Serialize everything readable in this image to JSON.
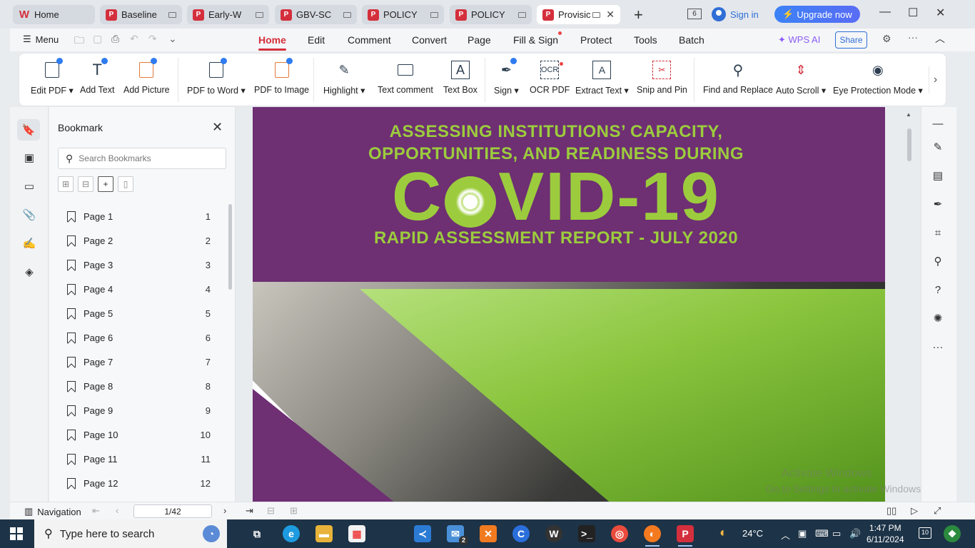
{
  "tabs": [
    {
      "label": "Home",
      "icon": "wps-home-icon"
    },
    {
      "label": "Baseline",
      "icon": "pdf-icon"
    },
    {
      "label": "Early-W",
      "icon": "pdf-icon"
    },
    {
      "label": "GBV-SC",
      "icon": "pdf-icon"
    },
    {
      "label": "POLICY",
      "icon": "pdf-icon"
    },
    {
      "label": "POLICY",
      "icon": "pdf-icon"
    },
    {
      "label": "Provisic",
      "icon": "pdf-icon",
      "active": true
    }
  ],
  "tab_count": "6",
  "sign_in": "Sign in",
  "upgrade": "Upgrade now",
  "menu_label": "Menu",
  "menu_tabs": [
    "Home",
    "Edit",
    "Comment",
    "Convert",
    "Page",
    "Fill & Sign",
    "Protect",
    "Tools",
    "Batch"
  ],
  "wps_ai": "WPS AI",
  "share": "Share",
  "ribbon": [
    {
      "label": "Edit PDF ▾",
      "icon": "edit-pdf-icon"
    },
    {
      "label": "Add Text",
      "icon": "add-text-icon"
    },
    {
      "label": "Add Picture",
      "icon": "add-picture-icon"
    },
    {
      "label": "PDF to Word ▾",
      "icon": "pdf-to-word-icon"
    },
    {
      "label": "PDF to Image",
      "icon": "pdf-to-image-icon"
    },
    {
      "label": "Highlight ▾",
      "icon": "highlight-icon"
    },
    {
      "label": "Text comment",
      "icon": "text-comment-icon"
    },
    {
      "label": "Text Box",
      "icon": "text-box-icon"
    },
    {
      "label": "Sign ▾",
      "icon": "sign-icon"
    },
    {
      "label": "OCR PDF",
      "icon": "ocr-icon"
    },
    {
      "label": "Extract Text ▾",
      "icon": "extract-text-icon"
    },
    {
      "label": "Snip and Pin",
      "icon": "snip-pin-icon"
    },
    {
      "label": "Find and Replace",
      "icon": "find-replace-icon"
    },
    {
      "label": "Auto Scroll ▾",
      "icon": "auto-scroll-icon"
    },
    {
      "label": "Eye Protection Mode ▾",
      "icon": "eye-protection-icon"
    }
  ],
  "bookmark_panel": {
    "title": "Bookmark",
    "search_placeholder": "Search Bookmarks",
    "items": [
      {
        "label": "Page 1",
        "num": "1"
      },
      {
        "label": "Page 2",
        "num": "2"
      },
      {
        "label": "Page 3",
        "num": "3"
      },
      {
        "label": "Page 4",
        "num": "4"
      },
      {
        "label": "Page 5",
        "num": "5"
      },
      {
        "label": "Page 6",
        "num": "6"
      },
      {
        "label": "Page 7",
        "num": "7"
      },
      {
        "label": "Page 8",
        "num": "8"
      },
      {
        "label": "Page 9",
        "num": "9"
      },
      {
        "label": "Page 10",
        "num": "10"
      },
      {
        "label": "Page 11",
        "num": "11"
      },
      {
        "label": "Page 12",
        "num": "12"
      }
    ]
  },
  "document": {
    "line1": "ASSESSING INSTITUTIONS’ CAPACITY,",
    "line2": "OPPORTUNITIES, AND READINESS DURING",
    "covid_prefix": "C",
    "covid_suffix": "VID-19",
    "line3": "RAPID ASSESSMENT REPORT - JULY 2020",
    "cover_purple": "#6e2f73",
    "cover_green": "#9ccc3d"
  },
  "watermark": {
    "line1": "Activate Windows",
    "line2": "Go to Settings to activate Windows."
  },
  "status": {
    "navigation": "Navigation",
    "page_value": "1/42"
  },
  "taskbar": {
    "search_placeholder": "Type here to search",
    "weather": "24°C",
    "time": "1:47 PM",
    "date": "6/11/2024",
    "notifications": "10",
    "mail_badge": "2"
  }
}
